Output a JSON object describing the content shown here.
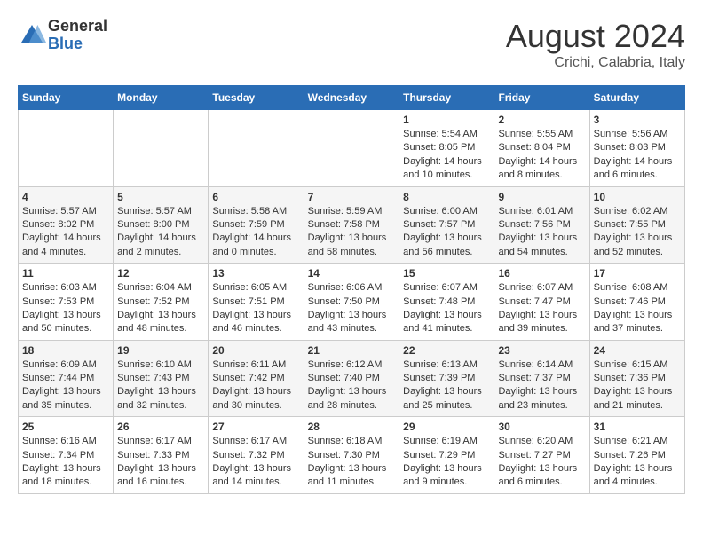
{
  "header": {
    "logo_general": "General",
    "logo_blue": "Blue",
    "month_year": "August 2024",
    "location": "Crichi, Calabria, Italy"
  },
  "calendar": {
    "days_of_week": [
      "Sunday",
      "Monday",
      "Tuesday",
      "Wednesday",
      "Thursday",
      "Friday",
      "Saturday"
    ],
    "weeks": [
      [
        {
          "day": "",
          "info": ""
        },
        {
          "day": "",
          "info": ""
        },
        {
          "day": "",
          "info": ""
        },
        {
          "day": "",
          "info": ""
        },
        {
          "day": "1",
          "info": "Sunrise: 5:54 AM\nSunset: 8:05 PM\nDaylight: 14 hours and 10 minutes."
        },
        {
          "day": "2",
          "info": "Sunrise: 5:55 AM\nSunset: 8:04 PM\nDaylight: 14 hours and 8 minutes."
        },
        {
          "day": "3",
          "info": "Sunrise: 5:56 AM\nSunset: 8:03 PM\nDaylight: 14 hours and 6 minutes."
        }
      ],
      [
        {
          "day": "4",
          "info": "Sunrise: 5:57 AM\nSunset: 8:02 PM\nDaylight: 14 hours and 4 minutes."
        },
        {
          "day": "5",
          "info": "Sunrise: 5:57 AM\nSunset: 8:00 PM\nDaylight: 14 hours and 2 minutes."
        },
        {
          "day": "6",
          "info": "Sunrise: 5:58 AM\nSunset: 7:59 PM\nDaylight: 14 hours and 0 minutes."
        },
        {
          "day": "7",
          "info": "Sunrise: 5:59 AM\nSunset: 7:58 PM\nDaylight: 13 hours and 58 minutes."
        },
        {
          "day": "8",
          "info": "Sunrise: 6:00 AM\nSunset: 7:57 PM\nDaylight: 13 hours and 56 minutes."
        },
        {
          "day": "9",
          "info": "Sunrise: 6:01 AM\nSunset: 7:56 PM\nDaylight: 13 hours and 54 minutes."
        },
        {
          "day": "10",
          "info": "Sunrise: 6:02 AM\nSunset: 7:55 PM\nDaylight: 13 hours and 52 minutes."
        }
      ],
      [
        {
          "day": "11",
          "info": "Sunrise: 6:03 AM\nSunset: 7:53 PM\nDaylight: 13 hours and 50 minutes."
        },
        {
          "day": "12",
          "info": "Sunrise: 6:04 AM\nSunset: 7:52 PM\nDaylight: 13 hours and 48 minutes."
        },
        {
          "day": "13",
          "info": "Sunrise: 6:05 AM\nSunset: 7:51 PM\nDaylight: 13 hours and 46 minutes."
        },
        {
          "day": "14",
          "info": "Sunrise: 6:06 AM\nSunset: 7:50 PM\nDaylight: 13 hours and 43 minutes."
        },
        {
          "day": "15",
          "info": "Sunrise: 6:07 AM\nSunset: 7:48 PM\nDaylight: 13 hours and 41 minutes."
        },
        {
          "day": "16",
          "info": "Sunrise: 6:07 AM\nSunset: 7:47 PM\nDaylight: 13 hours and 39 minutes."
        },
        {
          "day": "17",
          "info": "Sunrise: 6:08 AM\nSunset: 7:46 PM\nDaylight: 13 hours and 37 minutes."
        }
      ],
      [
        {
          "day": "18",
          "info": "Sunrise: 6:09 AM\nSunset: 7:44 PM\nDaylight: 13 hours and 35 minutes."
        },
        {
          "day": "19",
          "info": "Sunrise: 6:10 AM\nSunset: 7:43 PM\nDaylight: 13 hours and 32 minutes."
        },
        {
          "day": "20",
          "info": "Sunrise: 6:11 AM\nSunset: 7:42 PM\nDaylight: 13 hours and 30 minutes."
        },
        {
          "day": "21",
          "info": "Sunrise: 6:12 AM\nSunset: 7:40 PM\nDaylight: 13 hours and 28 minutes."
        },
        {
          "day": "22",
          "info": "Sunrise: 6:13 AM\nSunset: 7:39 PM\nDaylight: 13 hours and 25 minutes."
        },
        {
          "day": "23",
          "info": "Sunrise: 6:14 AM\nSunset: 7:37 PM\nDaylight: 13 hours and 23 minutes."
        },
        {
          "day": "24",
          "info": "Sunrise: 6:15 AM\nSunset: 7:36 PM\nDaylight: 13 hours and 21 minutes."
        }
      ],
      [
        {
          "day": "25",
          "info": "Sunrise: 6:16 AM\nSunset: 7:34 PM\nDaylight: 13 hours and 18 minutes."
        },
        {
          "day": "26",
          "info": "Sunrise: 6:17 AM\nSunset: 7:33 PM\nDaylight: 13 hours and 16 minutes."
        },
        {
          "day": "27",
          "info": "Sunrise: 6:17 AM\nSunset: 7:32 PM\nDaylight: 13 hours and 14 minutes."
        },
        {
          "day": "28",
          "info": "Sunrise: 6:18 AM\nSunset: 7:30 PM\nDaylight: 13 hours and 11 minutes."
        },
        {
          "day": "29",
          "info": "Sunrise: 6:19 AM\nSunset: 7:29 PM\nDaylight: 13 hours and 9 minutes."
        },
        {
          "day": "30",
          "info": "Sunrise: 6:20 AM\nSunset: 7:27 PM\nDaylight: 13 hours and 6 minutes."
        },
        {
          "day": "31",
          "info": "Sunrise: 6:21 AM\nSunset: 7:26 PM\nDaylight: 13 hours and 4 minutes."
        }
      ]
    ]
  }
}
